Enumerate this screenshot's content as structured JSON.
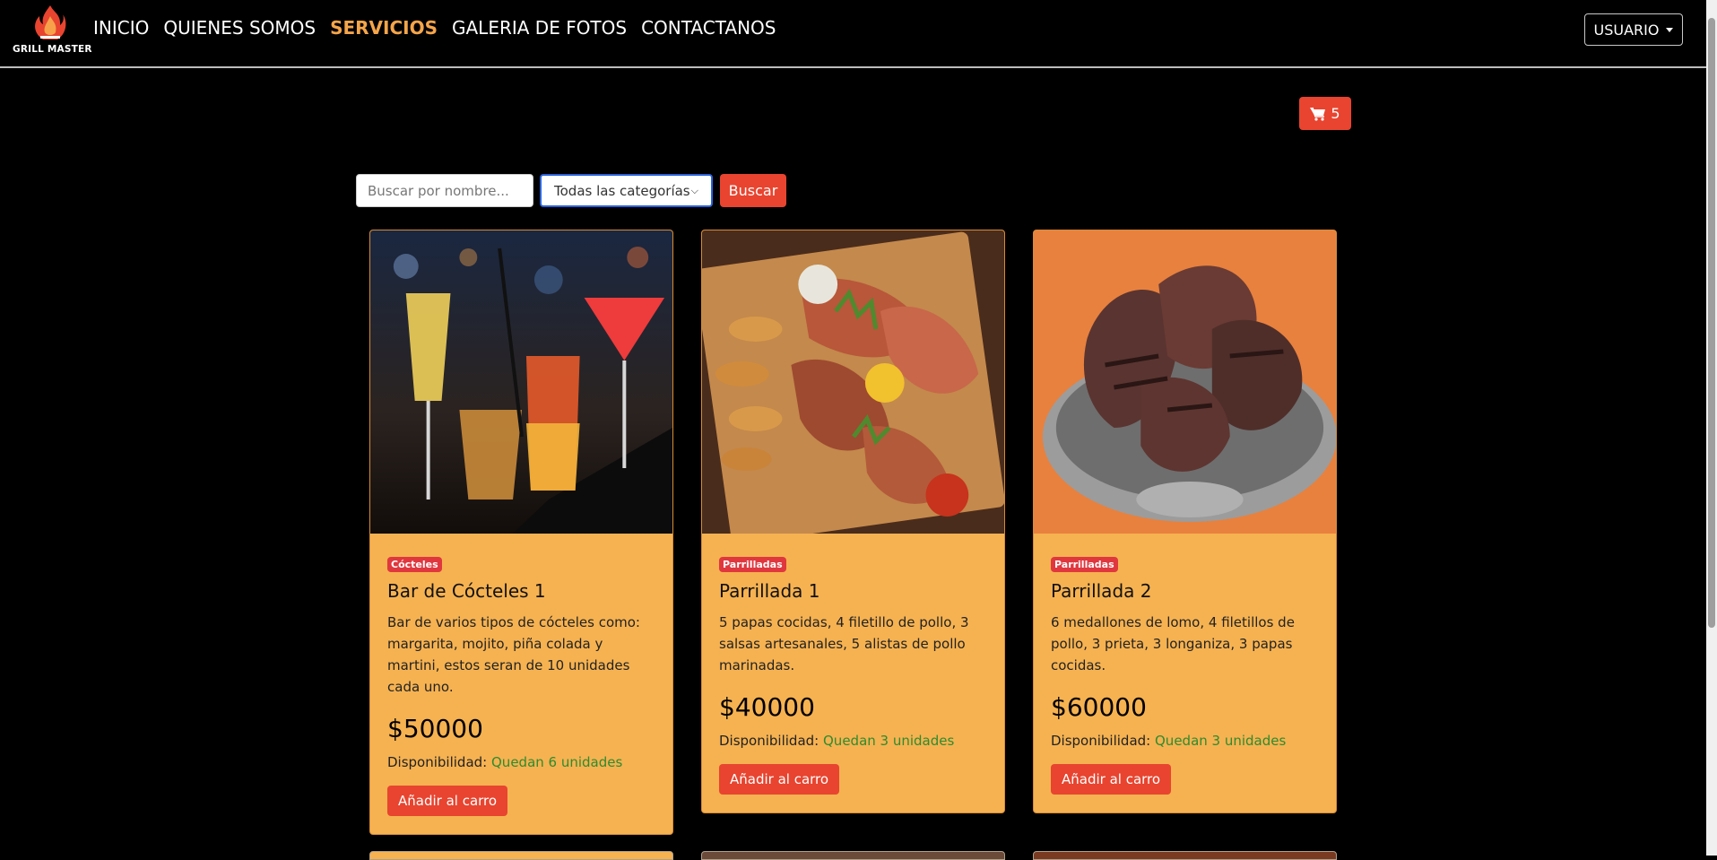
{
  "brand": {
    "logo_text": "GRILL MASTER",
    "logo_icon": "flame-grill-icon"
  },
  "nav": {
    "links": [
      {
        "label": "INICIO",
        "active": false
      },
      {
        "label": "QUIENES SOMOS",
        "active": false
      },
      {
        "label": "SERVICIOS",
        "active": true
      },
      {
        "label": "GALERIA DE FOTOS",
        "active": false
      },
      {
        "label": "CONTACTANOS",
        "active": false
      }
    ],
    "user_label": "USUARIO"
  },
  "cart": {
    "icon": "shopping-cart-icon",
    "count": "5"
  },
  "search": {
    "placeholder": "Buscar por nombre...",
    "category_selected": "Todas las categorías",
    "button_label": "Buscar"
  },
  "colors": {
    "accent": "#f5a54a",
    "button_red": "#e8442f",
    "card_bg": "#f6b251",
    "badge_red": "#e0373e",
    "availability_green": "#2e8b2e"
  },
  "products": [
    {
      "category": "Cócteles",
      "title": "Bar de Cócteles 1",
      "description": "Bar de varios tipos de cócteles como: margarita, mojito, piña colada y martini, estos seran de 10 unidades cada uno.",
      "price": "$50000",
      "availability_label": "Disponibilidad:",
      "availability_value": "Quedan 6 unidades",
      "button_label": "Añadir al carro"
    },
    {
      "category": "Parrilladas",
      "title": "Parrillada 1",
      "description": "5 papas cocidas, 4 filetillo de pollo, 3 salsas artesanales, 5 alistas de pollo marinadas.",
      "price": "$40000",
      "availability_label": "Disponibilidad:",
      "availability_value": "Quedan 3 unidades",
      "button_label": "Añadir al carro"
    },
    {
      "category": "Parrilladas",
      "title": "Parrillada 2",
      "description": "6 medallones de lomo, 4 filetillos de pollo, 3 prieta, 3 longaniza, 3 papas cocidas.",
      "price": "$60000",
      "availability_label": "Disponibilidad:",
      "availability_value": "Quedan 3 unidades",
      "button_label": "Añadir al carro"
    }
  ]
}
